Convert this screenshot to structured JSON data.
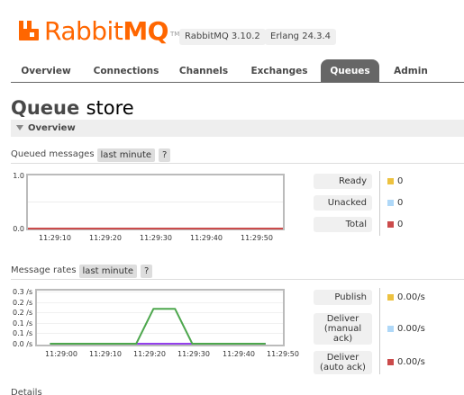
{
  "header": {
    "logo_rabbit": "Rabbit",
    "logo_mq": "MQ",
    "logo_tm": "TM",
    "version_rabbitmq": "RabbitMQ 3.10.2",
    "version_erlang": "Erlang 24.3.4",
    "brand_color": "#ff6600"
  },
  "tabs": [
    {
      "label": "Overview",
      "active": false
    },
    {
      "label": "Connections",
      "active": false
    },
    {
      "label": "Channels",
      "active": false
    },
    {
      "label": "Exchanges",
      "active": false
    },
    {
      "label": "Queues",
      "active": true
    },
    {
      "label": "Admin",
      "active": false
    }
  ],
  "page": {
    "title_prefix": "Queue",
    "title_name": "store",
    "overview_label": "Overview",
    "details_label": "Details"
  },
  "queued_messages": {
    "label": "Queued messages",
    "range": "last minute",
    "help": "?",
    "y_ticks": [
      "1.0",
      "0.0"
    ],
    "x_ticks": [
      "11:29:10",
      "11:29:20",
      "11:29:30",
      "11:29:40",
      "11:29:50"
    ],
    "legend": [
      {
        "label": "Ready",
        "value": "0",
        "color": "#edc240"
      },
      {
        "label": "Unacked",
        "value": "0",
        "color": "#afd8f8"
      },
      {
        "label": "Total",
        "value": "0",
        "color": "#cb4b4b"
      }
    ]
  },
  "message_rates": {
    "label": "Message rates",
    "range": "last minute",
    "help": "?",
    "y_ticks": [
      "0.3 /s",
      "0.2 /s",
      "0.2 /s",
      "0.1 /s",
      "0.1 /s",
      "0.0 /s"
    ],
    "x_ticks": [
      "11:29:00",
      "11:29:10",
      "11:29:20",
      "11:29:30",
      "11:29:40",
      "11:29:50"
    ],
    "legend": [
      {
        "label_lines": [
          "Publish"
        ],
        "value": "0.00/s",
        "color": "#edc240"
      },
      {
        "label_lines": [
          "Deliver",
          "(manual",
          "ack)"
        ],
        "value": "0.00/s",
        "color": "#afd8f8"
      },
      {
        "label_lines": [
          "Deliver",
          "(auto ack)"
        ],
        "value": "0.00/s",
        "color": "#cb4b4b"
      }
    ]
  },
  "chart_data": [
    {
      "type": "line",
      "title": "Queued messages",
      "x": [
        "11:29:05",
        "11:29:55"
      ],
      "ylim": [
        0,
        1.0
      ],
      "series": [
        {
          "name": "Ready",
          "values": [
            0,
            0
          ],
          "color": "#edc240"
        },
        {
          "name": "Unacked",
          "values": [
            0,
            0
          ],
          "color": "#afd8f8"
        },
        {
          "name": "Total",
          "values": [
            0,
            0
          ],
          "color": "#cb4b4b"
        }
      ],
      "grid": true
    },
    {
      "type": "line",
      "title": "Message rates",
      "x": [
        "11:29:00",
        "11:29:20",
        "11:29:24",
        "11:29:29",
        "11:29:33",
        "11:29:50"
      ],
      "ylim": [
        0,
        0.3
      ],
      "series": [
        {
          "name": "Publish",
          "values": [
            0,
            0,
            0.2,
            0.2,
            0,
            0
          ],
          "color": "#4da74d"
        },
        {
          "name": "Deliver (manual ack)",
          "values": [
            0,
            0,
            0,
            0,
            0,
            0
          ],
          "color": "#9440ed"
        }
      ],
      "grid": true
    }
  ]
}
